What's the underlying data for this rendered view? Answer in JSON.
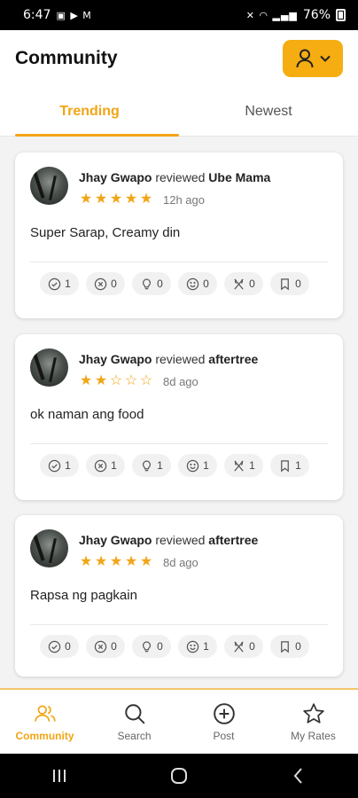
{
  "status_bar": {
    "time": "6:47",
    "battery": "76%"
  },
  "header": {
    "title": "Community"
  },
  "tabs": [
    {
      "label": "Trending",
      "active": true
    },
    {
      "label": "Newest",
      "active": false
    }
  ],
  "reviews": [
    {
      "user": "Jhay Gwapo",
      "verb": "reviewed",
      "place": "Ube Mama",
      "rating": 5,
      "stars": [
        "★",
        "★",
        "★",
        "★",
        "★"
      ],
      "time": "12h ago",
      "text": "Super Sarap, Creamy din",
      "reactions": [
        "1",
        "0",
        "0",
        "0",
        "0",
        "0"
      ]
    },
    {
      "user": "Jhay Gwapo",
      "verb": "reviewed",
      "place": "aftertree",
      "rating": 2,
      "stars": [
        "★",
        "★",
        "☆",
        "☆",
        "☆"
      ],
      "time": "8d ago",
      "text": "ok naman ang food",
      "reactions": [
        "1",
        "1",
        "1",
        "1",
        "1",
        "1"
      ]
    },
    {
      "user": "Jhay Gwapo",
      "verb": "reviewed",
      "place": "aftertree",
      "rating": 5,
      "stars": [
        "★",
        "★",
        "★",
        "★",
        "★"
      ],
      "time": "8d ago",
      "text": "Rapsa ng pagkain",
      "reactions": [
        "0",
        "0",
        "0",
        "1",
        "0",
        "0"
      ]
    }
  ],
  "reaction_icons": [
    "check-circle-icon",
    "x-circle-icon",
    "lightbulb-icon",
    "smile-icon",
    "utensils-icon",
    "bookmark-icon"
  ],
  "bottom_nav": [
    {
      "label": "Community",
      "icon": "users-icon",
      "active": true
    },
    {
      "label": "Search",
      "icon": "search-icon",
      "active": false
    },
    {
      "label": "Post",
      "icon": "plus-circle-icon",
      "active": false
    },
    {
      "label": "My Rates",
      "icon": "star-icon",
      "active": false
    }
  ],
  "colors": {
    "accent": "#f2a516",
    "background": "#f3f3f3"
  }
}
